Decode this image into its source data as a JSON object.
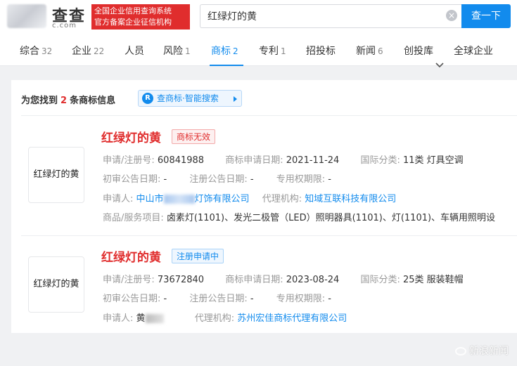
{
  "header": {
    "logo_text": "查查",
    "logo_sub": "c.com",
    "redbox_line1": "全国企业信用查询系统",
    "redbox_line2": "官方备案企业征信机构",
    "search_value": "红绿灯的黄",
    "search_button": "查一下"
  },
  "tabs": [
    {
      "label": "综合",
      "count": "32"
    },
    {
      "label": "企业",
      "count": "22"
    },
    {
      "label": "人员",
      "count": ""
    },
    {
      "label": "风险",
      "count": "1"
    },
    {
      "label": "商标",
      "count": "2"
    },
    {
      "label": "专利",
      "count": "1"
    },
    {
      "label": "招投标",
      "count": ""
    },
    {
      "label": "新闻",
      "count": "6"
    },
    {
      "label": "创投库",
      "count": ""
    },
    {
      "label": "全球企业",
      "count": ""
    }
  ],
  "results": {
    "found_prefix": "为您找到",
    "found_count": "2",
    "found_suffix": "条商标信息",
    "smart_search": "查商标·智能搜索"
  },
  "trademarks": [
    {
      "thumb_text": "红绿灯的黄",
      "name": "红绿灯的黄",
      "status": "商标无效",
      "reg_no_label": "申请/注册号:",
      "reg_no": "60841988",
      "apply_date_label": "商标申请日期:",
      "apply_date": "2021-11-24",
      "class_label": "国际分类:",
      "class": "11类 灯具空调",
      "prelim_label": "初审公告日期:",
      "prelim": "-",
      "reg_announce_label": "注册公告日期:",
      "reg_announce": "-",
      "exclusive_label": "专用权期限:",
      "exclusive": "-",
      "applicant_label": "申请人:",
      "applicant_prefix": "中山市",
      "applicant_suffix": "灯饰有限公司",
      "agent_label": "代理机构:",
      "agent": "知域互联科技有限公司",
      "goods_label": "商品/服务项目:",
      "goods": "卤素灯(1101)、发光二极管（LED）照明器具(1101)、灯(1101)、车辆用照明设"
    },
    {
      "thumb_text": "红绿灯的黄",
      "name": "红绿灯的黄",
      "status": "注册申请中",
      "reg_no_label": "申请/注册号:",
      "reg_no": "73672840",
      "apply_date_label": "商标申请日期:",
      "apply_date": "2023-08-24",
      "class_label": "国际分类:",
      "class": "25类 服装鞋帽",
      "prelim_label": "初审公告日期:",
      "prelim": "-",
      "reg_announce_label": "注册公告日期:",
      "reg_announce": "-",
      "exclusive_label": "专用权期限:",
      "exclusive": "-",
      "applicant_label": "申请人:",
      "applicant_prefix": "黄",
      "agent_label": "代理机构:",
      "agent": "苏州宏佳商标代理有限公司"
    }
  ],
  "watermark": "新浪新闻",
  "colors": {
    "accent": "#128bed",
    "red": "#e02d2d"
  }
}
